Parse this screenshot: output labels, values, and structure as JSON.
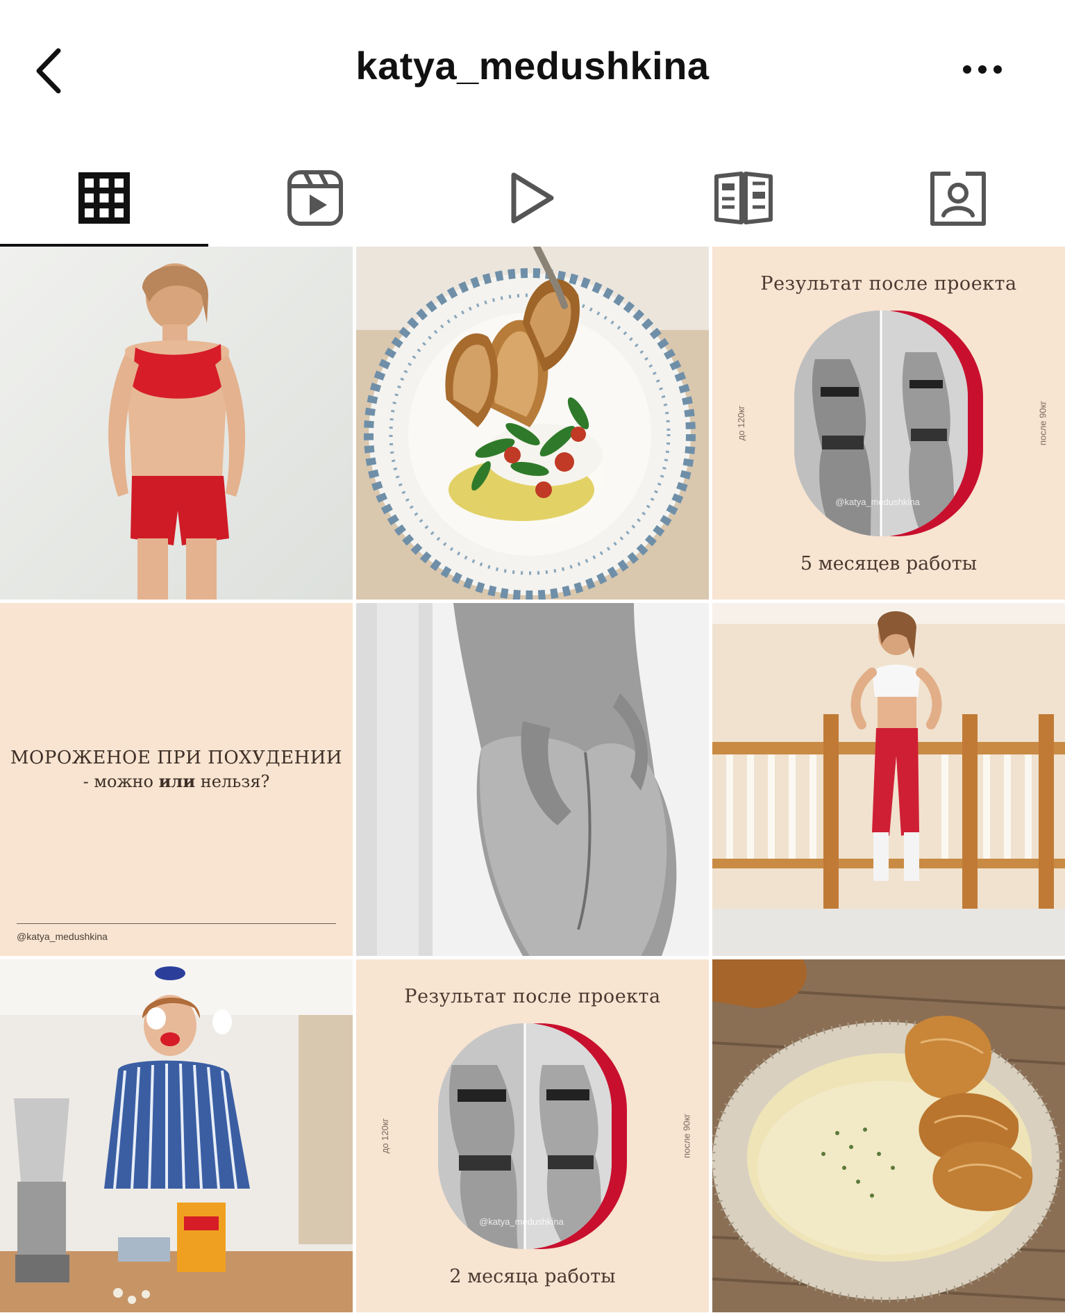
{
  "header": {
    "username": "katya_medushkina",
    "back_icon": "chevron-left-icon",
    "more_icon": "ellipsis-icon"
  },
  "tabs": [
    {
      "name": "posts-grid",
      "icon": "grid-icon",
      "active": true
    },
    {
      "name": "reels",
      "icon": "reels-icon",
      "active": false
    },
    {
      "name": "videos",
      "icon": "play-icon",
      "active": false
    },
    {
      "name": "guides",
      "icon": "guide-icon",
      "active": false
    },
    {
      "name": "tagged",
      "icon": "tagged-person-icon",
      "active": false
    }
  ],
  "posts": {
    "p1": {
      "kind": "photo",
      "subject": "woman in red sports top and shorts"
    },
    "p2": {
      "kind": "photo",
      "subject": "plate with toast, tomatoes and greens"
    },
    "p3": {
      "kind": "card",
      "title": "Результат после проекта",
      "left_note": "до 120кг",
      "right_note": "после 90кг",
      "watermark": "@katya_medushkina",
      "footer": "5 месяцев работы"
    },
    "p4": {
      "kind": "quote",
      "line1": "МОРОЖЕНОЕ ПРИ ПОХУДЕНИИ",
      "line2_pre": "- можно ",
      "line2_bold": "или",
      "line2_post": " нельзя?",
      "handle": "@katya_medushkina"
    },
    "p5": {
      "kind": "photo",
      "subject": "black and white body photo"
    },
    "p6": {
      "kind": "photo",
      "subject": "woman in red leggings by staircase railing"
    },
    "p7": {
      "kind": "photo",
      "subject": "woman holding eggs in kitchen with blender"
    },
    "p8": {
      "kind": "card",
      "title": "Результат после проекта",
      "left_note": "до 120кг",
      "right_note": "после 90кг",
      "watermark": "@katya_medushkina",
      "footer": "2 месяца работы"
    },
    "p9": {
      "kind": "photo",
      "subject": "bowl of cream soup with croissant"
    }
  },
  "colors": {
    "card_bg": "#f7e4d1",
    "accent_red": "#c8102e",
    "text": "#111111"
  }
}
